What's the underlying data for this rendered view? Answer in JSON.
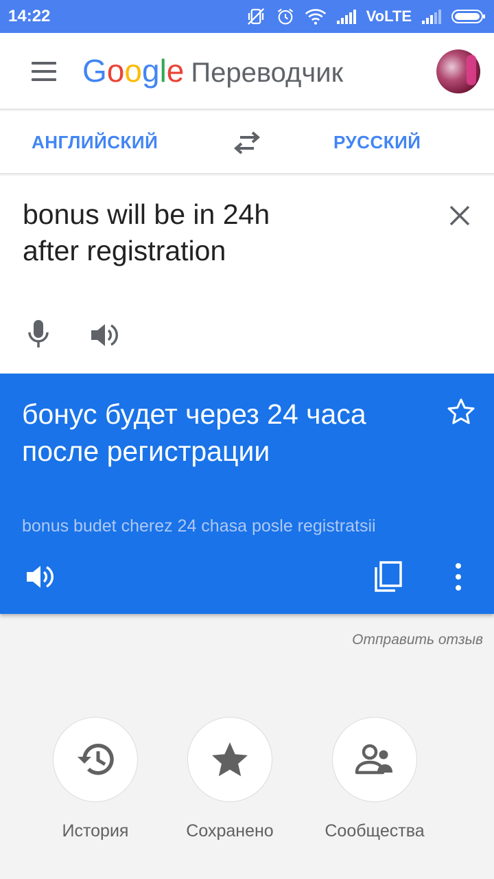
{
  "status_bar": {
    "time": "14:22",
    "network_label": "VoLTE",
    "icons": [
      "mute-vibrate-icon",
      "alarm-icon",
      "wifi-icon",
      "signal-icon",
      "signal-icon",
      "battery-icon"
    ]
  },
  "app_bar": {
    "logo_letters": [
      "G",
      "o",
      "o",
      "g",
      "l",
      "e"
    ],
    "product_name": "Переводчик",
    "menu_icon": "menu-icon",
    "avatar": "account-avatar"
  },
  "languages": {
    "source": "АНГЛИЙСКИЙ",
    "target": "РУССКИЙ",
    "swap_icon": "swap-icon"
  },
  "input": {
    "text_line1": "bonus will be in 24h",
    "text_line2": "after registration",
    "icons": [
      "close-icon",
      "microphone-icon",
      "speaker-icon"
    ]
  },
  "result": {
    "text_line1": "бонус будет через 24 часа",
    "text_line2": "после регистрации",
    "transliteration": "bonus budet cherez 24 chasa posle registratsii",
    "icons": [
      "star-outline-icon",
      "speaker-icon",
      "copy-icon",
      "more-vert-icon"
    ]
  },
  "feedback_link": "Отправить отзыв",
  "shortcuts": [
    {
      "label": "История",
      "icon": "history-icon"
    },
    {
      "label": "Сохранено",
      "icon": "star-icon"
    },
    {
      "label": "Сообщества",
      "icon": "community-icon"
    }
  ],
  "colors": {
    "status_bar": "#4a80f0",
    "accent_blue": "#4285f4",
    "result_card": "#1a73e8",
    "background": "#f3f3f3"
  }
}
